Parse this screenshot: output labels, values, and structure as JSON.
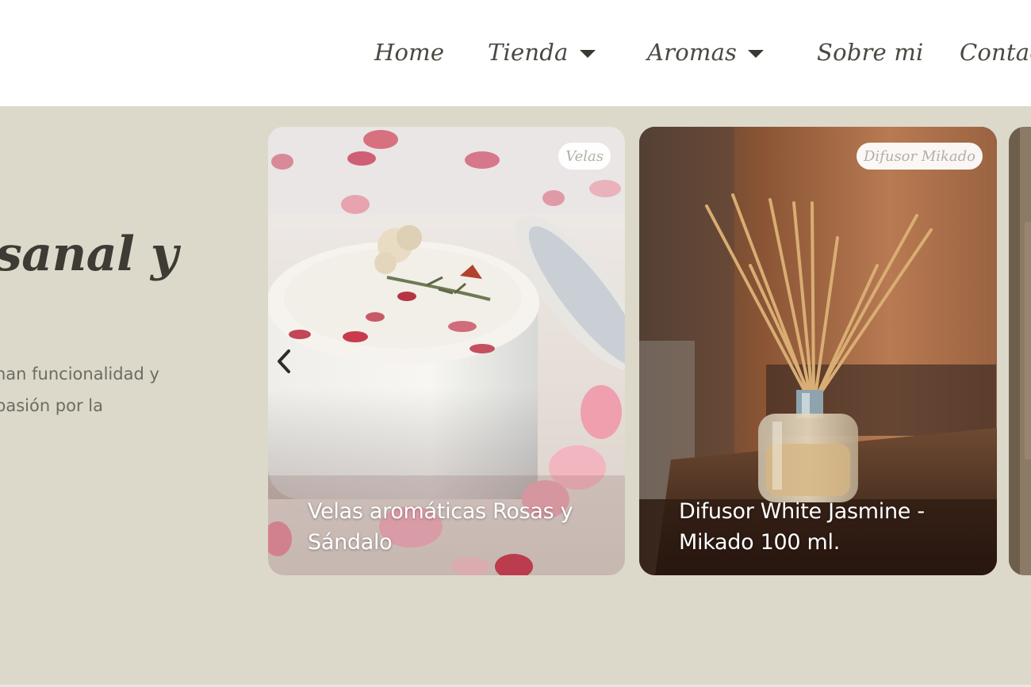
{
  "nav": {
    "items": [
      {
        "label": "Home",
        "has_dropdown": false
      },
      {
        "label": "Tienda",
        "has_dropdown": true
      },
      {
        "label": "Aromas",
        "has_dropdown": true
      },
      {
        "label": "Sobre mi",
        "has_dropdown": false
      },
      {
        "label": "Contac",
        "has_dropdown": false
      }
    ]
  },
  "hero": {
    "title": "sanal y",
    "description_lines": [
      "nan funcionalidad y",
      " pasión por la"
    ]
  },
  "carousel": {
    "cards": [
      {
        "tag": "Velas",
        "title": "Velas aromáticas Rosas y Sándalo"
      },
      {
        "tag": "Difusor Mikado",
        "title": "Difusor White Jasmine - Mikado 100 ml."
      }
    ],
    "prev_icon": "chevron-left-icon"
  },
  "colors": {
    "hero_bg": "#dcd9cb",
    "nav_text": "#4a4841",
    "tag_text": "#b4b0a6"
  }
}
